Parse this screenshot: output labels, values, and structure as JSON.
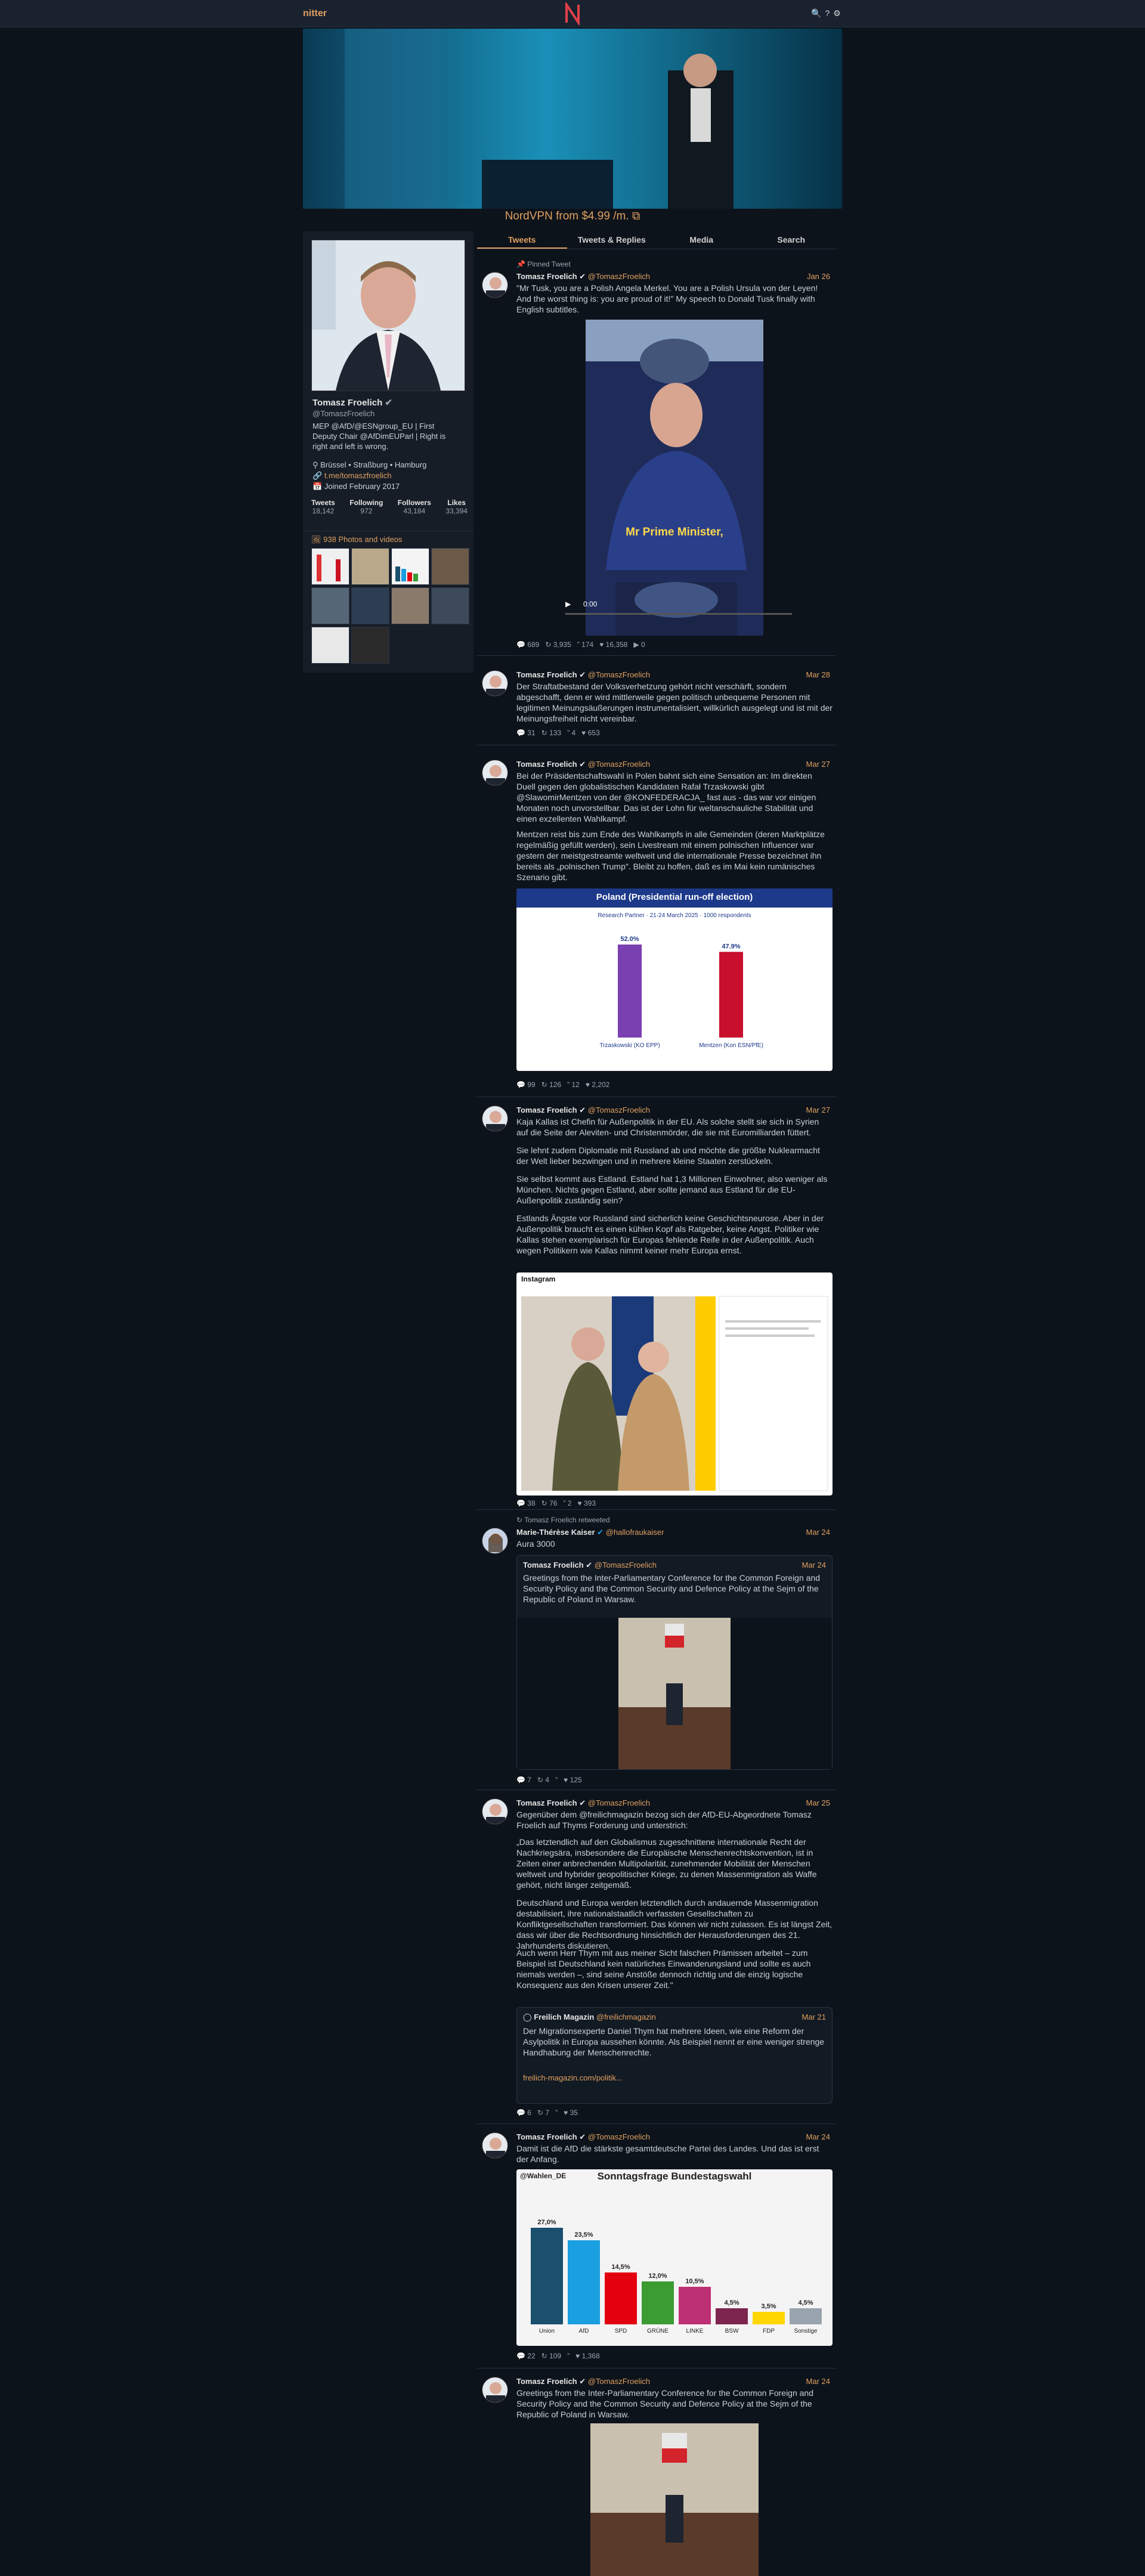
{
  "app": {
    "brand": "nitter",
    "icons": [
      "search-icon",
      "help-icon",
      "settings-icon"
    ]
  },
  "promo": {
    "text": "NordVPN from $4.99 /m. ⧉"
  },
  "profile": {
    "name": "Tomasz Froelich",
    "handle": "@TomaszFroelich",
    "bio_line1": "MEP @AfD/@ESNgroup_EU | First",
    "bio_line2": "Deputy Chair @AfDimEUParl | Right is",
    "bio_line3": "right and left is wrong.",
    "location": "Brüssel • Straßburg • Hamburg",
    "website": "t.me/tomaszfroelich",
    "joined": "Joined February 2017",
    "stats": [
      {
        "label": "Tweets",
        "value": "18,142"
      },
      {
        "label": "Following",
        "value": "972"
      },
      {
        "label": "Followers",
        "value": "43,184"
      },
      {
        "label": "Likes",
        "value": "33,394"
      }
    ],
    "gallery_title": "938 Photos and videos"
  },
  "tabs": [
    "Tweets",
    "Tweets & Replies",
    "Media",
    "Search"
  ],
  "tweets": [
    {
      "pinned_label": "Pinned Tweet",
      "name": "Tomasz Froelich",
      "handle": "@TomaszFroelich",
      "date": "Jan 26",
      "text": "\"Mr Tusk, you are a Polish Angela Merkel. You are a Polish Ursula von der Leyen! And the worst thing is: you are proud of it!\" My speech to Donald Tusk finally with English subtitles.",
      "video_caption": "Mr Prime Minister,",
      "video_time": "0:00",
      "stats": {
        "replies": "689",
        "retweets": "3,935",
        "quotes": "174",
        "likes": "16,358",
        "views": "0"
      }
    },
    {
      "name": "Tomasz Froelich",
      "handle": "@TomaszFroelich",
      "date": "Mar 28",
      "text": "Der Straftatbestand der Volksverhetzung gehört nicht verschärft, sondern abgeschafft, denn er wird mittlerweile gegen politisch unbequeme Personen mit legitimen Meinungsäußerungen instrumentalisiert, willkürlich ausgelegt und ist mit der Meinungsfreiheit nicht vereinbar.",
      "stats": {
        "replies": "31",
        "retweets": "133",
        "quotes": "4",
        "likes": "653"
      }
    },
    {
      "name": "Tomasz Froelich",
      "handle": "@TomaszFroelich",
      "date": "Mar 27",
      "text_p1": "Bei der Präsidentschaftswahl in Polen bahnt sich eine Sensation an: Im direkten Duell gegen den globalistischen Kandidaten Rafał Trzaskowski gibt @SlawomirMentzen von der @KONFEDERACJA_ fast aus - das war vor einigen Monaten noch unvorstellbar. Das ist der Lohn für weltanschauliche Stabilität und einen exzellenten Wahlkampf.",
      "text_p2": "Mentzen reist bis zum Ende des Wahlkampfs in alle Gemeinden (deren Marktplätze regelmäßig gefüllt werden), sein Livestream mit einem polnischen Influencer war gestern der meistgestreamte weltweit und die internationale Presse bezeichnet ihn bereits als „polnischen Trump\". Bleibt zu hoffen, daß es im Mai kein rumänisches Szenario gibt.",
      "poll_title": "Poland (Presidential run-off election)",
      "poll_sub": "Research Partner · 21-24 March 2025 · 1000 respondents",
      "stats": {
        "replies": "99",
        "retweets": "126",
        "quotes": "12",
        "likes": "2,202"
      }
    },
    {
      "name": "Tomasz Froelich",
      "handle": "@TomaszFroelich",
      "date": "Mar 27",
      "text_p1": "Kaja Kallas ist Chefin für Außenpolitik in der EU. Als solche stellt sie sich in Syrien auf die Seite der Aleviten- und Christenmörder, die sie mit Euromilliarden füttert.",
      "text_p2": "Sie lehnt zudem Diplomatie mit Russland ab und möchte die größte Nuklearmacht der Welt lieber bezwingen und in mehrere kleine Staaten zerstückeln.",
      "text_p3": "Sie selbst kommt aus Estland. Estland hat 1,3 Millionen Einwohner, also weniger als München. Nichts gegen Estland, aber sollte jemand aus Estland für die EU-Außenpolitik zuständig sein?",
      "text_p4": "Estlands Ängste vor Russland sind sicherlich keine Geschichtsneurose. Aber in der Außenpolitik braucht es einen kühlen Kopf als Ratgeber, keine Angst. Politiker wie Kallas stehen exemplarisch für Europas fehlende Reife in der Außenpolitik. Auch wegen Politikern wie Kallas nimmt keiner mehr Europa ernst.",
      "ig_brand": "Instagram",
      "stats": {
        "replies": "38",
        "retweets": "76",
        "quotes": "2",
        "likes": "393"
      }
    },
    {
      "retweet_label": "Tomasz Froelich retweeted",
      "name": "Marie-Thérèse Kaiser",
      "handle": "@hallofraukaiser",
      "date": "Mar 24",
      "text": "Aura 3000",
      "quote_name": "Tomasz Froelich",
      "quote_handle": "@TomaszFroelich",
      "quote_date": "Mar 24",
      "quote_text": "Greetings from the Inter-Parliamentary Conference for the Common Foreign and Security Policy and the Common Security and Defence Policy at the Sejm of the Republic of Poland in Warsaw.",
      "stats": {
        "replies": "7",
        "retweets": "4",
        "quotes": "",
        "likes": "125"
      }
    },
    {
      "name": "Tomasz Froelich",
      "handle": "@TomaszFroelich",
      "date": "Mar 25",
      "text_p1": "Gegenüber dem @freilichmagazin bezog sich der AfD-EU-Abgeordnete Tomasz Froelich auf Thyms Forderung und unterstrich:",
      "text_p2": "„Das letztendlich auf den Globalismus zugeschnittene internationale Recht der Nachkriegsära, insbesondere die Europäische Menschenrechtskonvention, ist in Zeiten einer anbrechenden Multipolarität, zunehmender Mobilität der Menschen weltweit und hybrider geopolitischer Kriege, zu denen Massenmigration als Waffe gehört, nicht länger zeitgemäß.",
      "text_p3": "Deutschland und Europa werden letztendlich durch andauernde Massenmigration destabilisiert, ihre nationalstaatlich verfassten Gesellschaften zu Konfliktgesellschaften transformiert. Das können wir nicht zulassen. Es ist längst Zeit, dass wir über die Rechtsordnung hinsichtlich der Herausforderungen des 21. Jahrhunderts diskutieren.",
      "text_p4": "Auch wenn Herr Thym mit aus meiner Sicht falschen Prämissen arbeitet – zum Beispiel ist Deutschland kein natürliches Einwanderungsland und sollte es auch niemals werden –, sind seine Anstöße dennoch richtig und die einzig logische Konsequenz aus den Krisen unserer Zeit.\"",
      "quote_name": "Freilich Magazin",
      "quote_handle": "@freilichmagazin",
      "quote_date": "Mar 21",
      "quote_text": "Der Migrationsexperte Daniel Thym hat mehrere Ideen, wie eine Reform der Asylpolitik in Europa aussehen könnte. Als Beispiel nennt er eine weniger strenge Handhabung der Menschenrechte.",
      "quote_link": "freilich-magazin.com/politik...",
      "stats": {
        "replies": "6",
        "retweets": "7",
        "quotes": "",
        "likes": "35"
      }
    },
    {
      "name": "Tomasz Froelich",
      "handle": "@TomaszFroelich",
      "date": "Mar 24",
      "text": "Damit ist die AfD die stärkste gesamtdeutsche Partei des Landes. Und das ist erst der Anfang.",
      "chart_title": "Sonntagsfrage Bundestagswahl",
      "chart_brand": "@Wahlen_DE",
      "stats": {
        "replies": "22",
        "retweets": "109",
        "quotes": "",
        "likes": "1,368"
      }
    },
    {
      "name": "Tomasz Froelich",
      "handle": "@TomaszFroelich",
      "date": "Mar 24",
      "text": "Greetings from the Inter-Parliamentary Conference for the Common Foreign and Security Policy and the Common Security and Defence Policy at the Sejm of the Republic of Poland in Warsaw."
    }
  ],
  "chart_data": [
    {
      "type": "bar",
      "title": "Poland (Presidential run-off election)",
      "categories": [
        "Trzaskowski (KO EPP)",
        "Mentzen (Kon ESN/PfE)"
      ],
      "values": [
        52.0,
        47.9
      ],
      "ylim": [
        0,
        60
      ]
    },
    {
      "type": "bar",
      "title": "Sonntagsfrage Bundestagswahl",
      "categories": [
        "Union",
        "AfD",
        "SPD",
        "GRÜNE",
        "LINKE",
        "BSW",
        "FDP",
        "Sonstige"
      ],
      "values": [
        27.0,
        23.5,
        14.5,
        12.0,
        10.5,
        4.5,
        3.5,
        4.5
      ],
      "colors": [
        "#1a4f6e",
        "#1a9fe0",
        "#e3000f",
        "#3a9c32",
        "#be3075",
        "#7d254f",
        "#ffd600",
        "#9aa4af"
      ],
      "ylim": [
        0,
        30
      ]
    }
  ]
}
